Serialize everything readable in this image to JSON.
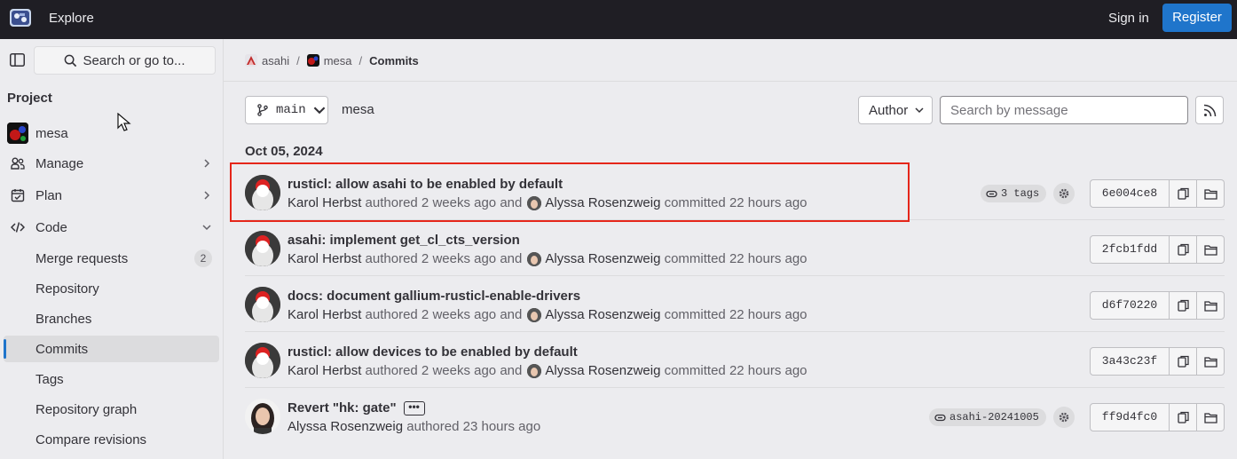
{
  "topbar": {
    "explore": "Explore",
    "sign_in": "Sign in",
    "register": "Register"
  },
  "sidebar": {
    "search_label": "Search or go to...",
    "heading": "Project",
    "project_name": "mesa",
    "sections": [
      {
        "label": "Manage"
      },
      {
        "label": "Plan"
      },
      {
        "label": "Code"
      }
    ],
    "code_items": [
      {
        "label": "Merge requests",
        "count": "2"
      },
      {
        "label": "Repository"
      },
      {
        "label": "Branches"
      },
      {
        "label": "Commits"
      },
      {
        "label": "Tags"
      },
      {
        "label": "Repository graph"
      },
      {
        "label": "Compare revisions"
      }
    ]
  },
  "breadcrumb": [
    "asahi",
    "mesa",
    "Commits"
  ],
  "toolbar": {
    "branch": "main",
    "path": "mesa",
    "author": "Author",
    "search_placeholder": "Search by message"
  },
  "date_heading": "Oct 05, 2024",
  "commits": [
    {
      "title": "rusticl: allow asahi to be enabled by default",
      "author": "Karol Herbst",
      "authored": "authored 2 weeks ago and",
      "committer": "Alyssa Rosenzweig",
      "committed": "committed 22 hours ago",
      "tag": "3 tags",
      "sha": "6e004ce8"
    },
    {
      "title": "asahi: implement get_cl_cts_version",
      "author": "Karol Herbst",
      "authored": "authored 2 weeks ago and",
      "committer": "Alyssa Rosenzweig",
      "committed": "committed 22 hours ago",
      "sha": "2fcb1fdd"
    },
    {
      "title": "docs: document gallium-rusticl-enable-drivers",
      "author": "Karol Herbst",
      "authored": "authored 2 weeks ago and",
      "committer": "Alyssa Rosenzweig",
      "committed": "committed 22 hours ago",
      "sha": "d6f70220"
    },
    {
      "title": "rusticl: allow devices to be enabled by default",
      "author": "Karol Herbst",
      "authored": "authored 2 weeks ago and",
      "committer": "Alyssa Rosenzweig",
      "committed": "committed 22 hours ago",
      "sha": "3a43c23f"
    },
    {
      "title": "Revert \"hk: gate\"",
      "ellipsis": "•••",
      "author": "Alyssa Rosenzweig",
      "authored": "authored 23 hours ago",
      "tag": "asahi-20241005",
      "sha": "ff9d4fc0"
    }
  ],
  "colors": {
    "topbar": "#1f1e24",
    "accent": "#1f75cb",
    "highlight": "#e5261a"
  }
}
